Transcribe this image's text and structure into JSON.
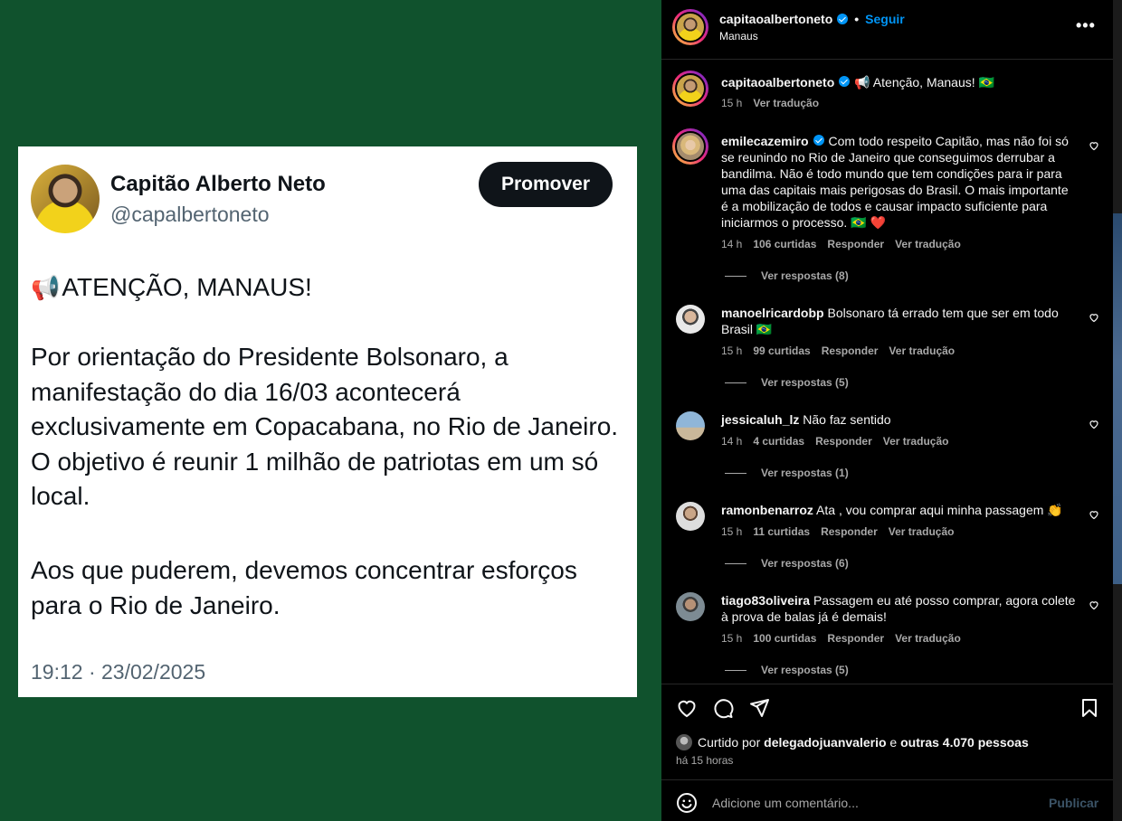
{
  "tweet": {
    "name": "Capitão Alberto Neto",
    "handle": "@capalbertoneto",
    "promote_label": "Promover",
    "headline_icon": "📢",
    "headline": "ATENÇÃO, MANAUS!",
    "paragraph1": "Por orientação do Presidente Bolsonaro, a manifestação do dia 16/03 acontecerá exclusivamente em Copacabana, no Rio de Janeiro. O objetivo é reunir 1 milhão de patriotas em um só local.",
    "paragraph2": "Aos que puderem, devemos concentrar esforços para o Rio de Janeiro.",
    "timestamp": "19:12 · 23/02/2025"
  },
  "header": {
    "username": "capitaoalbertoneto",
    "separator": "•",
    "follow_label": "Seguir",
    "location": "Manaus",
    "more_label": "•••"
  },
  "caption": {
    "username": "capitaoalbertoneto",
    "text": "📢 Atenção, Manaus! 🇧🇷",
    "time": "15 h",
    "translate": "Ver tradução"
  },
  "comments": [
    {
      "username": "emilecazemiro",
      "verified": true,
      "text": "Com todo respeito Capitão, mas não foi só se reunindo no Rio de Janeiro que conseguimos derrubar a bandilma. Não é todo mundo que tem condições para ir para uma das capitais mais perigosas do Brasil. O mais importante é a mobilização de todos e causar impacto suficiente para iniciarmos o processo. 🇧🇷 ❤️",
      "time": "14 h",
      "likes": "106 curtidas",
      "reply": "Responder",
      "translate": "Ver tradução",
      "replies": "Ver respostas (8)"
    },
    {
      "username": "manoelricardobp",
      "verified": false,
      "text": "Bolsonaro tá errado tem que ser em todo Brasil 🇧🇷",
      "time": "15 h",
      "likes": "99 curtidas",
      "reply": "Responder",
      "translate": "Ver tradução",
      "replies": "Ver respostas (5)"
    },
    {
      "username": "jessicaluh_lz",
      "verified": false,
      "text": "Não faz sentido",
      "time": "14 h",
      "likes": "4 curtidas",
      "reply": "Responder",
      "translate": "Ver tradução",
      "replies": "Ver respostas (1)"
    },
    {
      "username": "ramonbenarroz",
      "verified": false,
      "text": "Ata , vou comprar aqui minha passagem 👏",
      "time": "15 h",
      "likes": "11 curtidas",
      "reply": "Responder",
      "translate": "Ver tradução",
      "replies": "Ver respostas (6)"
    },
    {
      "username": "tiago83oliveira",
      "verified": false,
      "text": "Passagem eu até posso comprar, agora colete à prova de balas já é demais!",
      "time": "15 h",
      "likes": "100 curtidas",
      "reply": "Responder",
      "translate": "Ver tradução",
      "replies": "Ver respostas (5)"
    }
  ],
  "likes": {
    "prefix": "Curtido por",
    "user": "delegadojuanvalerio",
    "middle": "e",
    "others": "outras 4.070 pessoas"
  },
  "posted_ago": "há 15 horas",
  "comment_box": {
    "placeholder": "Adicione um comentário...",
    "publish_label": "Publicar"
  },
  "colors": {
    "media_background": "#10522d",
    "accent_blue": "#0095f6",
    "muted_text": "#a8a8a8"
  },
  "icons": [
    "megaphone-icon",
    "verified-badge-icon",
    "more-options-icon",
    "heart-icon",
    "comment-icon",
    "share-icon",
    "bookmark-icon",
    "emoji-icon"
  ]
}
